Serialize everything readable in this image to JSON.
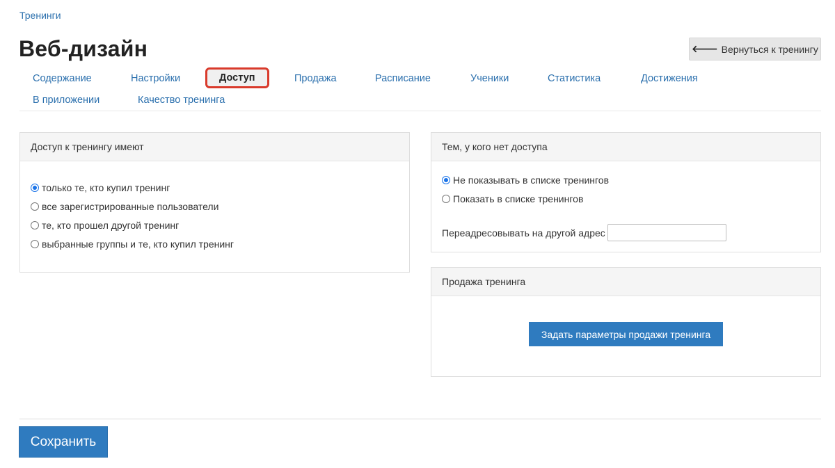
{
  "breadcrumb": "Тренинги",
  "title": "Веб-дизайн",
  "back_button": "Вернуться к тренингу",
  "tabs": {
    "content": "Содержание",
    "settings": "Настройки",
    "access": "Доступ",
    "sale": "Продажа",
    "schedule": "Расписание",
    "students": "Ученики",
    "stats": "Статистика",
    "achievements": "Достижения",
    "in_app": "В приложении",
    "quality": "Качество тренинга"
  },
  "access_panel": {
    "header": "Доступ к тренингу имеют",
    "options": [
      "только те, кто купил тренинг",
      "все зарегистрированные пользователи",
      "те, кто прошел другой тренинг",
      "выбранные группы и те, кто купил тренинг"
    ],
    "selected_index": 0
  },
  "no_access_panel": {
    "header": "Тем, у кого нет доступа",
    "options": [
      "Не показывать в списке тренингов",
      "Показать в списке тренингов"
    ],
    "selected_index": 0,
    "redirect_label": "Переадресовывать на другой адрес",
    "redirect_value": ""
  },
  "sale_panel": {
    "header": "Продажа тренинга",
    "button": "Задать параметры продажи тренинга"
  },
  "save_button": "Сохранить",
  "colors": {
    "link": "#2a6fad",
    "primary_button": "#2f7bbf",
    "active_tab_highlight": "#d93a2b",
    "radio_checked": "#1a73e8"
  },
  "icons": {
    "back": "arrow-left-icon"
  }
}
